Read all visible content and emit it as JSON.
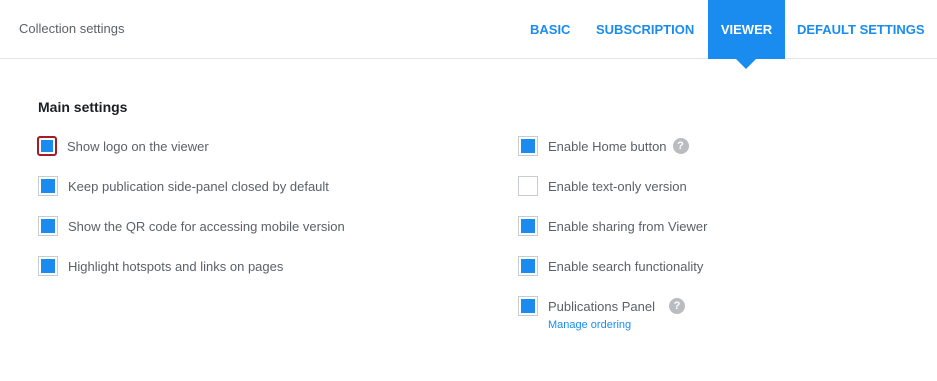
{
  "header": {
    "title": "Collection settings",
    "tabs": {
      "basic": "BASIC",
      "subscription": "SUBSCRIPTION",
      "viewer": "VIEWER",
      "default_settings": "DEFAULT SETTINGS"
    },
    "active_tab": "VIEWER"
  },
  "main": {
    "section_title": "Main settings",
    "left": [
      {
        "label": "Show logo on the viewer",
        "checked": true,
        "focused": true
      },
      {
        "label": "Keep publication side-panel closed by default",
        "checked": true
      },
      {
        "label": "Show the QR code for accessing mobile version",
        "checked": true
      },
      {
        "label": "Highlight hotspots and links on pages",
        "checked": true
      }
    ],
    "right": [
      {
        "label": "Enable Home button",
        "checked": true,
        "help": "?"
      },
      {
        "label": "Enable text-only version",
        "checked": false
      },
      {
        "label": "Enable sharing from Viewer",
        "checked": true
      },
      {
        "label": "Enable search functionality",
        "checked": true
      },
      {
        "label": "Publications Panel",
        "checked": true,
        "help": "?",
        "link": "Manage ordering"
      }
    ]
  },
  "colors": {
    "accent": "#1a8cf0",
    "focus_ring": "#a51c22",
    "help_icon": "#b9bdc2"
  },
  "icons": {
    "help": "question-mark-circle-icon",
    "tab_indicator": "caret-down-icon"
  }
}
